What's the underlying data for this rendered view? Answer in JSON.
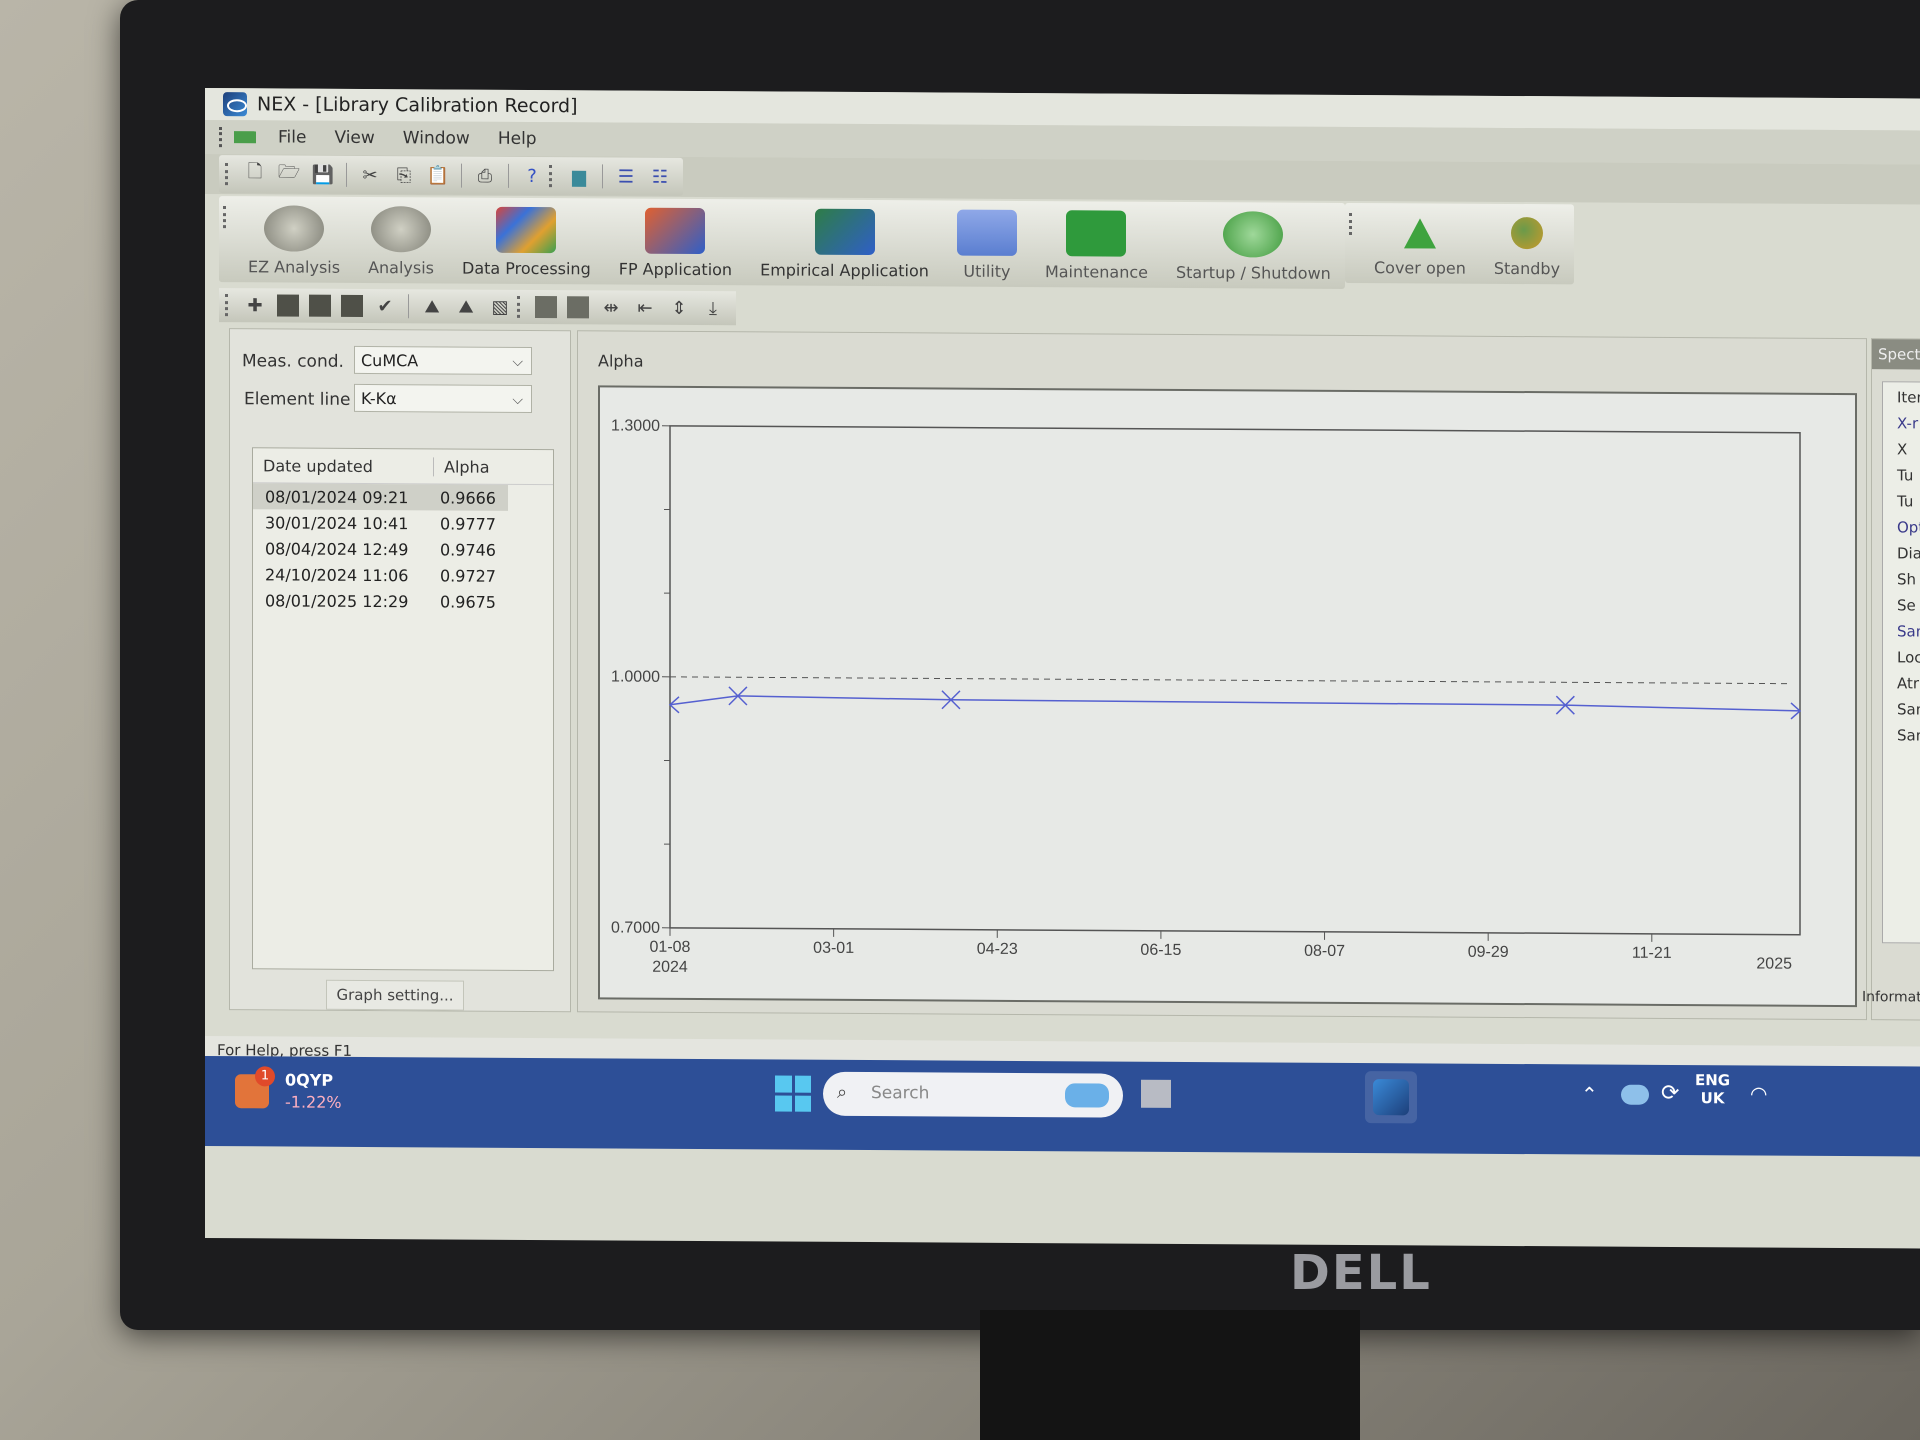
{
  "window": {
    "title": "NEX - [Library Calibration Record]"
  },
  "menu": [
    "File",
    "View",
    "Window",
    "Help"
  ],
  "toolbar_icons": [
    "new-icon",
    "open-icon",
    "save-icon",
    "cut-icon",
    "copy-icon",
    "paste-icon",
    "print-icon",
    "help-icon",
    "window-icon",
    "cascade-icon",
    "tile-icon"
  ],
  "big_toolbar": [
    {
      "label": "EZ Analysis",
      "icon": "ez-analysis-icon",
      "color": "#8c8c80"
    },
    {
      "label": "Analysis",
      "icon": "analysis-icon",
      "color": "#8c8c80"
    },
    {
      "label": "Data Processing",
      "icon": "data-processing-icon",
      "color": "#d8453a"
    },
    {
      "label": "FP Application",
      "icon": "fp-application-icon",
      "color": "#2f5fc8"
    },
    {
      "label": "Empirical Application",
      "icon": "empirical-application-icon",
      "color": "#2e7d46"
    },
    {
      "label": "Utility",
      "icon": "utility-icon",
      "color": "#5a7ed0"
    },
    {
      "label": "Maintenance",
      "icon": "maintenance-icon",
      "color": "#2f9a3c"
    },
    {
      "label": "Startup / Shutdown",
      "icon": "startup-shutdown-icon",
      "color": "#4aa548"
    }
  ],
  "big_toolbar2": [
    {
      "label": "Cover open",
      "icon": "cover-open-icon",
      "color": "#3ea33e"
    },
    {
      "label": "Standby",
      "icon": "standby-icon",
      "color": "#c99a2a"
    }
  ],
  "left": {
    "meas_cond_label": "Meas. cond.",
    "meas_cond_value": "CuMCA",
    "element_line_label": "Element line",
    "element_line_value": "K-Kα",
    "columns": [
      "Date updated",
      "Alpha"
    ],
    "rows": [
      {
        "date": "08/01/2024 09:21",
        "alpha": "0.9666",
        "selected": true
      },
      {
        "date": "30/01/2024 10:41",
        "alpha": "0.9777"
      },
      {
        "date": "08/04/2024 12:49",
        "alpha": "0.9746"
      },
      {
        "date": "24/10/2024 11:06",
        "alpha": "0.9727"
      },
      {
        "date": "08/01/2025 12:29",
        "alpha": "0.9675"
      }
    ],
    "graph_setting_label": "Graph setting..."
  },
  "chart_data": {
    "type": "line",
    "title": "Alpha",
    "xlabel": "",
    "ylabel": "",
    "ylim": [
      0.7,
      1.3
    ],
    "y_ticks": [
      "1.3000",
      "1.0000",
      "0.7000"
    ],
    "x_ticks": [
      "01-08",
      "03-01",
      "04-23",
      "06-15",
      "08-07",
      "09-29",
      "11-21"
    ],
    "x_year_labels": [
      "2024",
      "2025"
    ],
    "reference_line": 1.0,
    "x_range_days": [
      0,
      366
    ],
    "series": [
      {
        "name": "Alpha",
        "color": "#5560d0",
        "points": [
          {
            "day": 0,
            "value": 0.9666,
            "marker": "arrow-left"
          },
          {
            "day": 22,
            "value": 0.9777,
            "marker": "x"
          },
          {
            "day": 91,
            "value": 0.9746,
            "marker": "x"
          },
          {
            "day": 290,
            "value": 0.9727,
            "marker": "x"
          },
          {
            "day": 366,
            "value": 0.9675,
            "marker": "arrow-right"
          }
        ]
      }
    ]
  },
  "right_panel": {
    "tab": "Spectro",
    "items": [
      "Item",
      "X-r",
      "X",
      "Tu",
      "Tu",
      "Opt",
      "Dia",
      "Sh",
      "Se",
      "Sam",
      "Loc",
      "Atr",
      "San",
      "San"
    ],
    "footer": "Information"
  },
  "statusbar": {
    "text": "For Help, press F1"
  },
  "taskbar": {
    "stock_symbol": "0QYP",
    "stock_change": "-1.22%",
    "notification_count": "1",
    "search_placeholder": "Search",
    "lang": "ENG",
    "region": "UK"
  },
  "monitor_brand": "DELL"
}
